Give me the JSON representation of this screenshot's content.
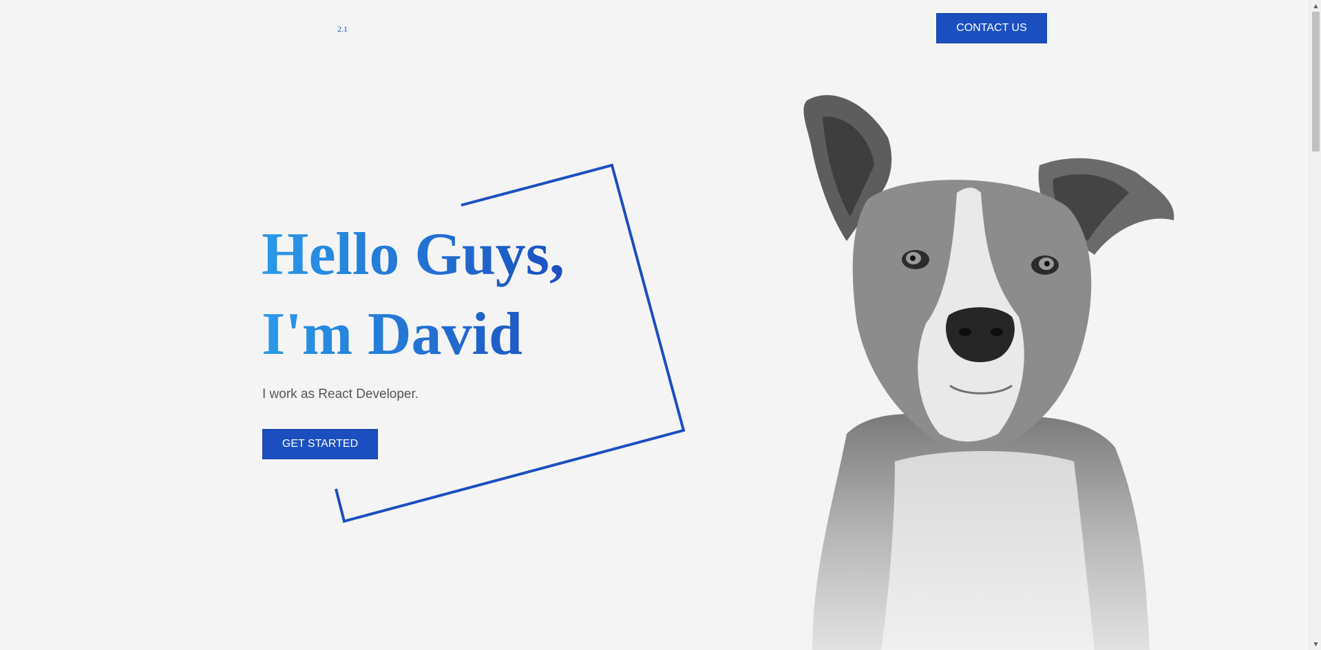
{
  "header": {
    "logo_text": "2.1",
    "contact_label": "CONTACT US"
  },
  "hero": {
    "title_line1": "Hello Guys,",
    "title_line2": "I'm David",
    "subtitle": "I work as React Developer.",
    "cta_label": "GET STARTED"
  },
  "image": {
    "subject": "black-and-white dog portrait"
  },
  "colors": {
    "accent": "#1b4fbf",
    "gradient_start": "#2a9ae8",
    "background": "#f4f4f5",
    "subtitle_text": "#555555"
  },
  "scrollbar": {
    "up_icon": "scroll-up-arrow-icon",
    "down_icon": "scroll-down-arrow-icon"
  }
}
